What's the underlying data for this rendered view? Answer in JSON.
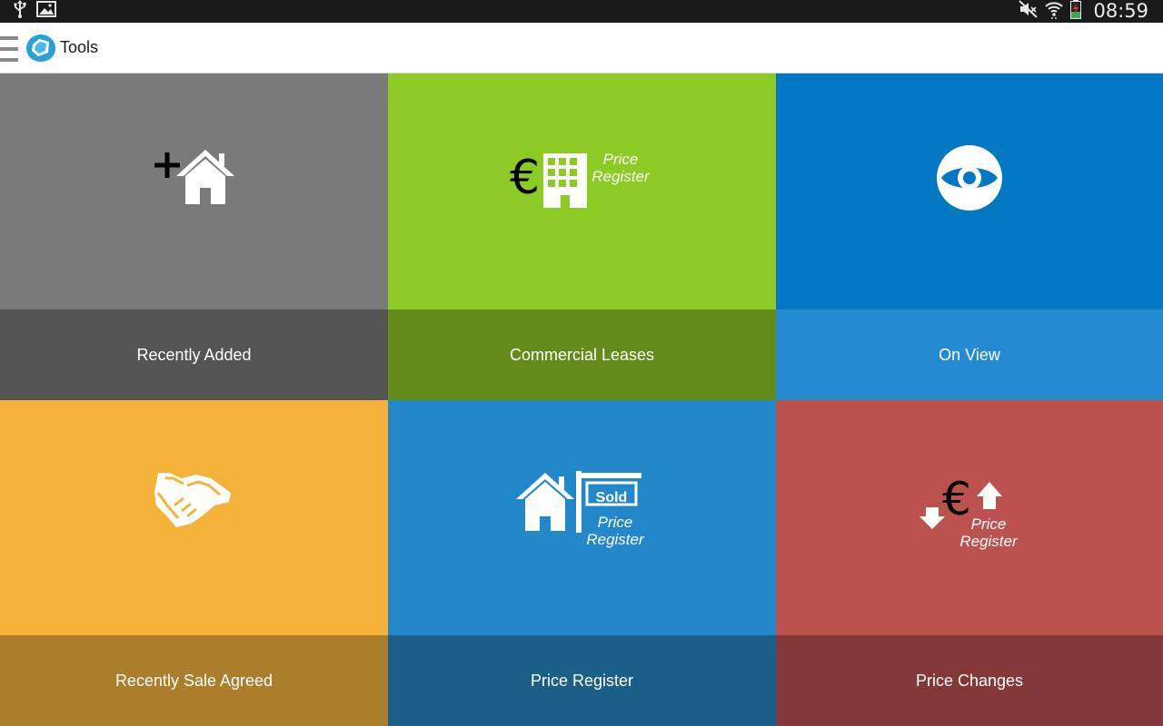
{
  "status_bar": {
    "time": "08:59",
    "left_icons": [
      "usb-icon",
      "image-notification-icon"
    ],
    "right_icons": [
      "mute-icon",
      "wifi-icon",
      "battery-icon"
    ]
  },
  "action_bar": {
    "title": "Tools",
    "menu_icon": "hamburger-menu-icon",
    "logo": "app-logo"
  },
  "tiles": [
    {
      "label": "Recently Added",
      "icon": "add-house-icon",
      "color": "#7a7a7a",
      "caption_color": "#545454"
    },
    {
      "label": "Commercial Leases",
      "icon": "euro-building-icon",
      "icon_text": [
        "Price",
        "Register"
      ],
      "color": "#8cca24",
      "caption_color": "#628b1a"
    },
    {
      "label": "On View",
      "icon": "eye-icon",
      "color": "#0277c2",
      "caption_color": "#248bd0"
    },
    {
      "label": "Recently Sale Agreed",
      "icon": "handshake-icon",
      "color": "#f6b33a",
      "caption_color": "#ac7d2b"
    },
    {
      "label": "Price Register",
      "icon": "sold-sign-house-icon",
      "icon_text": [
        "Sold",
        "Price",
        "Register"
      ],
      "color": "#2388ca",
      "caption_color": "#1b5e88"
    },
    {
      "label": "Price Changes",
      "icon": "euro-up-down-icon",
      "icon_text": [
        "Price",
        "Register"
      ],
      "color": "#bb524e",
      "caption_color": "#833837"
    }
  ]
}
